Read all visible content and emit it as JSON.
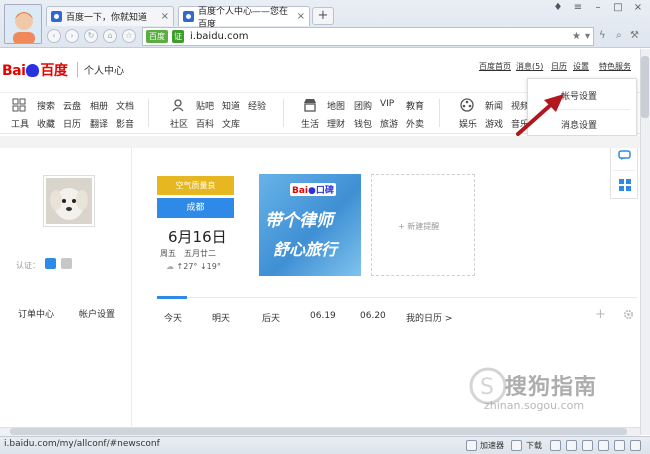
{
  "browser": {
    "tabs": [
      {
        "title": "百度一下，你就知道"
      },
      {
        "title": "百度个人中心——您在百度"
      }
    ],
    "new_tab": "+",
    "url_badge1": "百度",
    "url_badge2": "证",
    "url": "i.baidu.com",
    "status_url": "i.baidu.com/my/allconf/#newsconf",
    "status_items": {
      "accelerator": "加速器",
      "download": "下载"
    }
  },
  "header": {
    "logo_text_red": "Bai",
    "logo_text_red2": "百度",
    "title": "个人中心",
    "links": [
      "百度首页",
      "消息(5)",
      "日历",
      "设置",
      "特色服务"
    ]
  },
  "services": {
    "group1_row1": [
      "搜索",
      "云盘",
      "相册",
      "文档"
    ],
    "group1_row2": [
      "工具",
      "收藏",
      "日历",
      "翻译",
      "影音"
    ],
    "group2_row1": [
      "贴吧",
      "知道",
      "经验"
    ],
    "group2_row2": [
      "社区",
      "百科",
      "文库"
    ],
    "group3_row1": [
      "地图",
      "团购",
      "VIP",
      "教育"
    ],
    "group3_row2": [
      "生活",
      "理财",
      "钱包",
      "旅游",
      "外卖"
    ],
    "group4_row1": [
      "新闻",
      "视频"
    ],
    "group4_row2": [
      "娱乐",
      "游戏",
      "音乐"
    ]
  },
  "dropdown": {
    "items": [
      "帐号设置",
      "消息设置"
    ]
  },
  "profile": {
    "auth_label": "认证：",
    "links": [
      "订单中心",
      "帐户设置"
    ]
  },
  "weather": {
    "air": "空气质量良",
    "city": "成都",
    "date": "6月16日",
    "day": "周五　五月廿二",
    "temp": "↑27° ↓19°"
  },
  "ad": {
    "brand": "Bai",
    "brand2": "口碑",
    "line1": "带个律师",
    "line2": "舒心旅行"
  },
  "add_reminder": "+ 新建提醒",
  "date_tabs": [
    "今天",
    "明天",
    "后天",
    "06.19",
    "06.20",
    "我的日历 >"
  ],
  "watermark": {
    "text": "搜狗指南",
    "url": "zhinan.sogou.com"
  },
  "colors": {
    "baidu_red": "#e10602",
    "baidu_blue": "#2932e1",
    "accent_blue": "#2e8ae6",
    "air_yellow": "#e6b720"
  }
}
